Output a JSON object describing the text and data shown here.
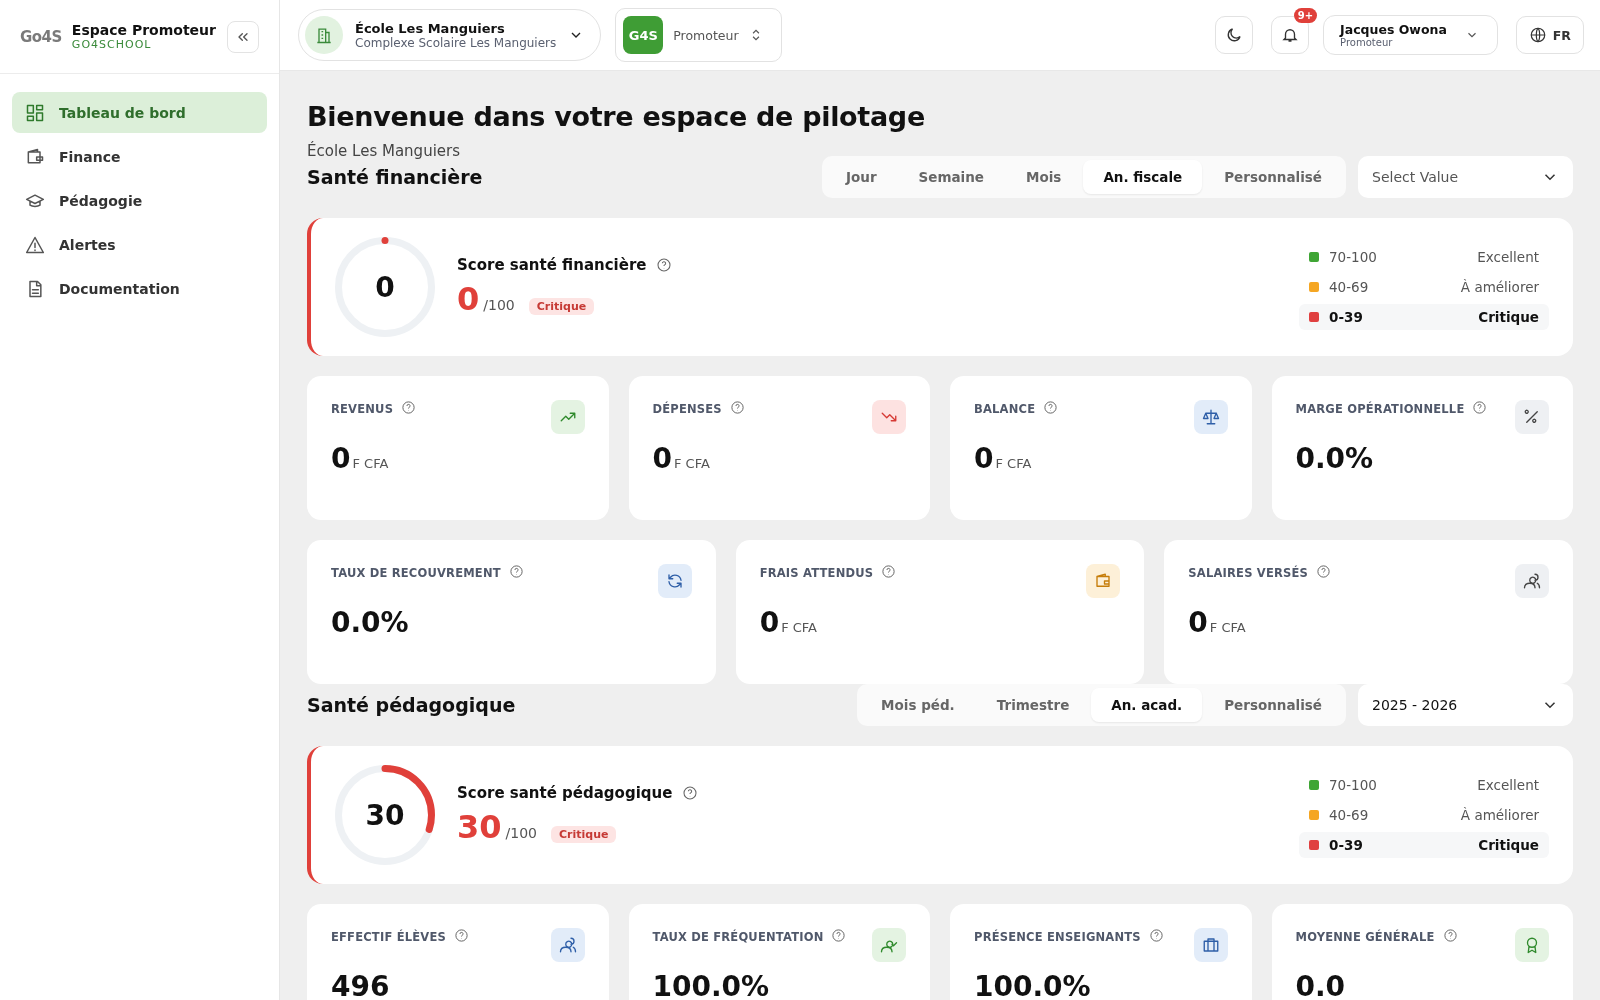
{
  "brand": {
    "logo": "Go4S",
    "title": "Espace Promoteur",
    "subtitle": "GO4SCHOOL"
  },
  "sidebar": {
    "items": [
      {
        "label": "Tableau de bord",
        "kind": "grid",
        "selected": true
      },
      {
        "label": "Finance",
        "kind": "wallet",
        "selected": false
      },
      {
        "label": "Pédagogie",
        "kind": "cap",
        "selected": false
      },
      {
        "label": "Alertes",
        "kind": "alert",
        "selected": false
      },
      {
        "label": "Documentation",
        "kind": "doc",
        "selected": false
      }
    ]
  },
  "header": {
    "school": {
      "name": "École Les Manguiers",
      "complex": "Complexe Scolaire Les Manguiers"
    },
    "role_switch": {
      "badge": "G4S",
      "label": "Promoteur"
    },
    "notifications": {
      "count": "9+"
    },
    "user": {
      "name": "Jacques Owona",
      "role": "Promoteur"
    },
    "language": "FR"
  },
  "page": {
    "title": "Bienvenue dans votre espace de pilotage",
    "subtitle": "École Les Manguiers"
  },
  "sections": [
    {
      "title": "Santé financière",
      "periods": [
        {
          "label": "Jour",
          "selected": false
        },
        {
          "label": "Semaine",
          "selected": false
        },
        {
          "label": "Mois",
          "selected": false
        },
        {
          "label": "An. fiscale",
          "selected": true
        },
        {
          "label": "Personnalisé",
          "selected": false
        }
      ],
      "select": {
        "placeholder": "Select Value"
      },
      "score": {
        "title": "Score santé financière",
        "gauge_value": "0",
        "value": "0",
        "max": "/100",
        "status": "Critique",
        "level": 0,
        "legend": [
          {
            "range": "70-100",
            "label": "Excellent",
            "color": "#3fa535",
            "selected": false
          },
          {
            "range": "40-69",
            "label": "À améliorer",
            "color": "#f5a623",
            "selected": false
          },
          {
            "range": "0-39",
            "label": "Critique",
            "color": "#e04040",
            "selected": true
          }
        ]
      },
      "kpi_rows": [
        [
          {
            "label": "REVENUS",
            "value": "0",
            "unit": "F CFA",
            "kind": "trend-up"
          },
          {
            "label": "DÉPENSES",
            "value": "0",
            "unit": "F CFA",
            "kind": "trend-down"
          },
          {
            "label": "BALANCE",
            "value": "0",
            "unit": "F CFA",
            "kind": "scale"
          },
          {
            "label": "MARGE OPÉRATIONNELLE",
            "value": "0.0%",
            "kind": "percent"
          }
        ],
        [
          {
            "label": "TAUX DE RECOUVREMENT",
            "value": "0.0%",
            "kind": "refresh"
          },
          {
            "label": "FRAIS ATTENDUS",
            "value": "0",
            "unit": "F CFA",
            "kind": "wallet"
          },
          {
            "label": "SALAIRES VERSÉS",
            "value": "0",
            "unit": "F CFA",
            "kind": "users"
          }
        ]
      ]
    },
    {
      "title": "Santé pédagogique",
      "periods": [
        {
          "label": "Mois péd.",
          "selected": false
        },
        {
          "label": "Trimestre",
          "selected": false
        },
        {
          "label": "An. acad.",
          "selected": true
        },
        {
          "label": "Personnalisé",
          "selected": false
        }
      ],
      "select": {
        "value": "2025 - 2026"
      },
      "score": {
        "title": "Score santé pédagogique",
        "gauge_value": "30",
        "value": "30",
        "max": "/100",
        "status": "Critique",
        "level": 0.3,
        "legend": [
          {
            "range": "70-100",
            "label": "Excellent",
            "color": "#3fa535",
            "selected": false
          },
          {
            "range": "40-69",
            "label": "À améliorer",
            "color": "#f5a623",
            "selected": false
          },
          {
            "range": "0-39",
            "label": "Critique",
            "color": "#e04040",
            "selected": true
          }
        ]
      },
      "kpi_rows": [
        [
          {
            "label": "EFFECTIF ÉLÈVES",
            "value": "496",
            "kind": "users-blue"
          },
          {
            "label": "TAUX DE FRÉQUENTATION",
            "value": "100.0%",
            "kind": "user-check"
          },
          {
            "label": "PRÉSENCE ENSEIGNANTS",
            "value": "100.0%",
            "kind": "briefcase"
          },
          {
            "label": "MOYENNE GÉNÉRALE",
            "value": "0.0",
            "kind": "award"
          }
        ]
      ]
    }
  ]
}
